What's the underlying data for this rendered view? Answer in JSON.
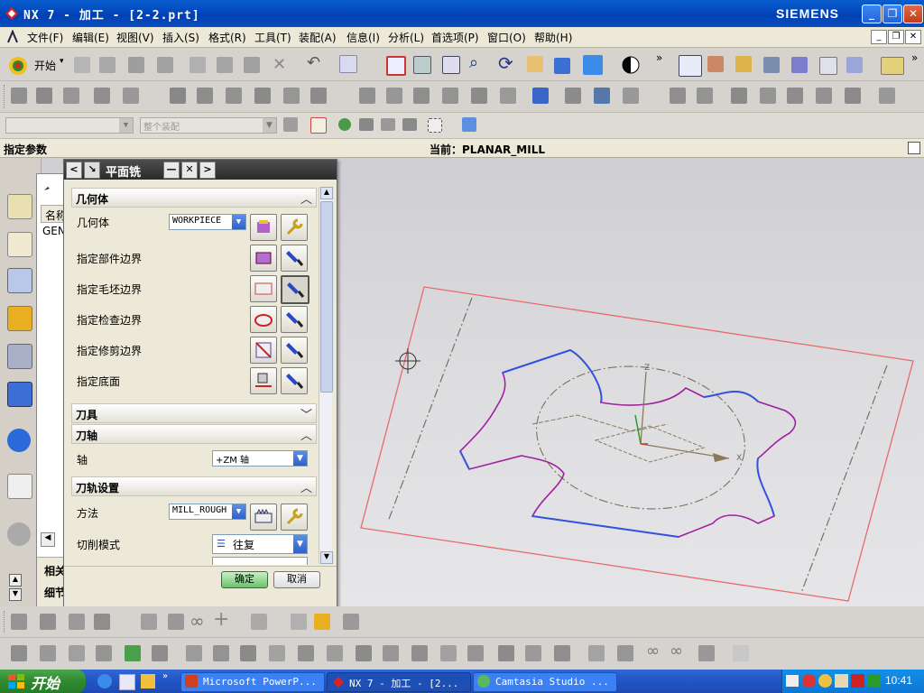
{
  "window": {
    "title": "NX 7 - 加工 - [2-2.prt]",
    "brand": "SIEMENS"
  },
  "menu": [
    "文件(F)",
    "编辑(E)",
    "视图(V)",
    "插入(S)",
    "格式(R)",
    "工具(T)",
    "装配(A)",
    "信息(I)",
    "分析(L)",
    "首选项(P)",
    "窗口(O)",
    "帮助(H)"
  ],
  "toolbar": {
    "start_label": "开始",
    "assembly_filter": "整个装配"
  },
  "status": {
    "left": "指定参数",
    "current": "当前：PLANAR_MILL"
  },
  "navigator": {
    "col_name": "名称",
    "root_item": "GEN",
    "related": "相关",
    "detail": "细节"
  },
  "dialog": {
    "title": "平面铣",
    "sections": {
      "geometry": "几何体",
      "tool": "刀具",
      "axis": "刀轴",
      "path": "刀轨设置"
    },
    "rows": {
      "geometry_label": "几何体",
      "geometry_value": "WORKPIECE",
      "part_boundary": "指定部件边界",
      "blank_boundary": "指定毛坯边界",
      "check_boundary": "指定检查边界",
      "trim_boundary": "指定修剪边界",
      "floor": "指定底面",
      "axis_label": "轴",
      "axis_value": "+ZM 轴",
      "method_label": "方法",
      "method_value": "MILL_ROUGH",
      "cut_mode_label": "切削模式",
      "cut_mode_value": "往复"
    },
    "ok": "确定",
    "cancel": "取消"
  },
  "taskbar": {
    "start": "开始",
    "items": [
      "Microsoft PowerP...",
      "NX 7 - 加工 - [2...",
      "Camtasia Studio ..."
    ],
    "clock": "10:41"
  },
  "colors": {
    "boundary_red": "#e86a6a",
    "profile_blue": "#3355dd",
    "profile_purple": "#a020a0",
    "viewport_bg": "#d9d9dc"
  }
}
